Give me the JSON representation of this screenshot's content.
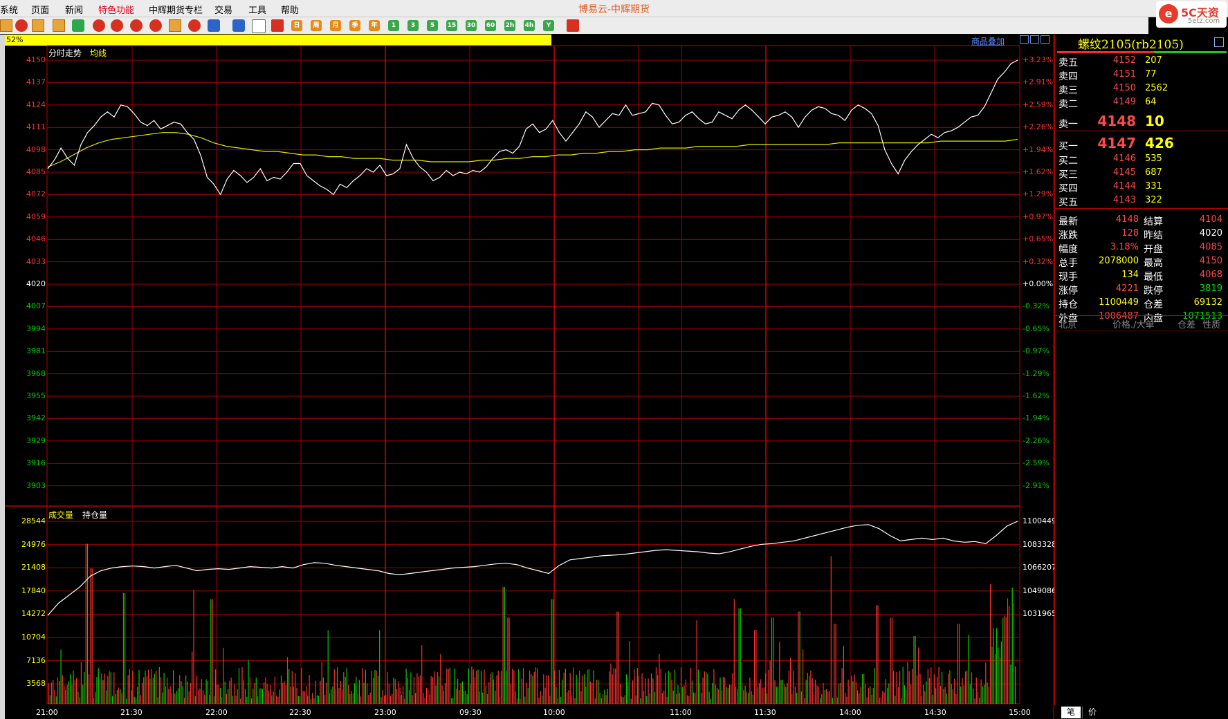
{
  "window": {
    "title": "博易云-中辉期货",
    "logo_brand": "5C天资",
    "logo_url": "5etz.com"
  },
  "menu": [
    "系统",
    "页面",
    "新闻",
    "特色功能",
    "中辉期货专栏",
    "交易",
    "工具",
    "帮助"
  ],
  "toolbar": {
    "period_buttons": [
      "日",
      "周",
      "月",
      "季",
      "年",
      "1",
      "3",
      "5",
      "15",
      "30",
      "60",
      "2h",
      "4h",
      "Y"
    ]
  },
  "progress": {
    "label": "52%",
    "value": 0.52
  },
  "overlay_link": "商品叠加",
  "price_panel": {
    "legend_1": "分时走势",
    "legend_2": "均线",
    "y_left": [
      "4150",
      "4137",
      "4124",
      "4111",
      "4098",
      "4085",
      "4072",
      "4059",
      "4046",
      "4033",
      "4020",
      "4007",
      "3994",
      "3981",
      "3968",
      "3955",
      "3942",
      "3929",
      "3916",
      "3903"
    ],
    "y_right": [
      "+3.23%",
      "+2.91%",
      "+2.59%",
      "+2.26%",
      "+1.94%",
      "+1.62%",
      "+1.29%",
      "+0.97%",
      "+0.65%",
      "+0.32%",
      "+0.00%",
      "-0.32%",
      "-0.65%",
      "-0.97%",
      "-1.29%",
      "-1.62%",
      "-1.94%",
      "-2.26%",
      "-2.59%",
      "-2.91%"
    ]
  },
  "volume_panel": {
    "legend_1": "成交量",
    "legend_2": "持仓量",
    "y_left": [
      "28544",
      "24976",
      "21408",
      "17840",
      "14272",
      "10704",
      "7136",
      "3568"
    ],
    "y_right": [
      "1100449",
      "1083328",
      "1066207",
      "1049086",
      "1031965"
    ]
  },
  "x_labels": [
    "21:00",
    "21:30",
    "22:00",
    "22:30",
    "23:00",
    "09:30",
    "10:00",
    "11:00",
    "11:30",
    "14:00",
    "14:30",
    "15:00"
  ],
  "colors": {
    "grid": "#a00000",
    "price_line": "#ffffff",
    "avg_line": "#e6e600",
    "up": "#ff3030",
    "down": "#00d000",
    "flat": "#ffffff",
    "yellow": "#ffff00"
  },
  "quote": {
    "title": "螺纹2105(rb2105)",
    "asks": [
      {
        "label": "卖五",
        "price": "4152",
        "vol": "207"
      },
      {
        "label": "卖四",
        "price": "4151",
        "vol": "77"
      },
      {
        "label": "卖三",
        "price": "4150",
        "vol": "2562"
      },
      {
        "label": "卖二",
        "price": "4149",
        "vol": "64"
      },
      {
        "label": "卖一",
        "price": "4148",
        "vol": "10"
      }
    ],
    "bids": [
      {
        "label": "买一",
        "price": "4147",
        "vol": "426"
      },
      {
        "label": "买二",
        "price": "4146",
        "vol": "535"
      },
      {
        "label": "买三",
        "price": "4145",
        "vol": "687"
      },
      {
        "label": "买四",
        "price": "4144",
        "vol": "331"
      },
      {
        "label": "买五",
        "price": "4143",
        "vol": "322"
      }
    ],
    "stats": [
      {
        "k1": "最新",
        "v1": "4148",
        "c1": "#ff4848",
        "k2": "结算",
        "v2": "4104",
        "c2": "#ff4848"
      },
      {
        "k1": "涨跌",
        "v1": "128",
        "c1": "#ff4848",
        "k2": "昨结",
        "v2": "4020",
        "c2": "#ffffff"
      },
      {
        "k1": "幅度",
        "v1": "3.18%",
        "c1": "#ff4848",
        "k2": "开盘",
        "v2": "4085",
        "c2": "#ff4848"
      },
      {
        "k1": "总手",
        "v1": "2078000",
        "c1": "#ffff00",
        "k2": "最高",
        "v2": "4150",
        "c2": "#ff4848"
      },
      {
        "k1": "现手",
        "v1": "134",
        "c1": "#ffff00",
        "k2": "最低",
        "v2": "4068",
        "c2": "#ff4848"
      },
      {
        "k1": "涨停",
        "v1": "4221",
        "c1": "#ff4848",
        "k2": "跌停",
        "v2": "3819",
        "c2": "#00e000"
      },
      {
        "k1": "持仓",
        "v1": "1100449",
        "c1": "#ffff00",
        "k2": "仓差",
        "v2": "69132",
        "c2": "#ffff00"
      },
      {
        "k1": "外盘",
        "v1": "1006487",
        "c1": "#ff4848",
        "k2": "内盘",
        "v2": "1071513",
        "c2": "#00e000"
      }
    ],
    "tick_header": [
      "北京",
      "价格",
      "./大单",
      "仓差",
      "性质"
    ],
    "bottom_tabs": [
      "笔",
      "价"
    ]
  }
}
